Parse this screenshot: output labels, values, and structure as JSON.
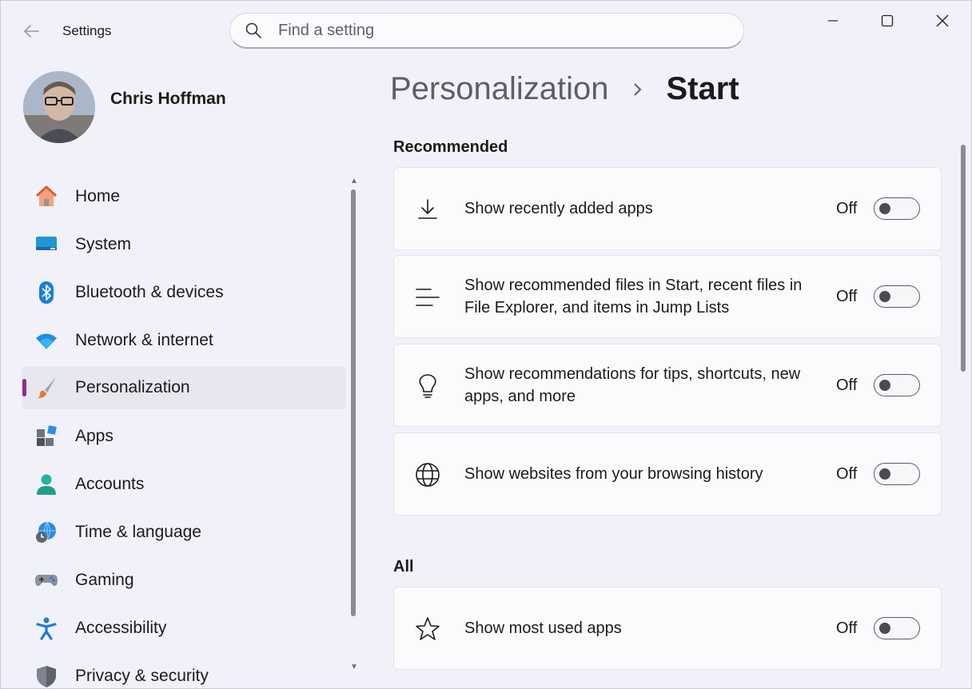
{
  "window": {
    "title": "Settings"
  },
  "search": {
    "placeholder": "Find a setting"
  },
  "profile": {
    "name": "Chris Hoffman"
  },
  "breadcrumb": {
    "parent": "Personalization",
    "separator": "›",
    "current": "Start"
  },
  "nav": {
    "items": [
      {
        "label": "Home",
        "icon": "home-icon"
      },
      {
        "label": "System",
        "icon": "system-display-icon"
      },
      {
        "label": "Bluetooth & devices",
        "icon": "bluetooth-icon"
      },
      {
        "label": "Network & internet",
        "icon": "wifi-icon"
      },
      {
        "label": "Personalization",
        "icon": "paintbrush-icon",
        "selected": true
      },
      {
        "label": "Apps",
        "icon": "apps-icon"
      },
      {
        "label": "Accounts",
        "icon": "person-icon"
      },
      {
        "label": "Time & language",
        "icon": "globe-clock-icon"
      },
      {
        "label": "Gaming",
        "icon": "gamepad-icon"
      },
      {
        "label": "Accessibility",
        "icon": "accessibility-icon"
      },
      {
        "label": "Privacy & security",
        "icon": "shield-icon"
      }
    ]
  },
  "sections": {
    "recommended": {
      "label": "Recommended",
      "settings": [
        {
          "label": "Show recently added apps",
          "state": "Off",
          "icon": "download-icon"
        },
        {
          "label": "Show recommended files in Start, recent files in File Explorer, and items in Jump Lists",
          "state": "Off",
          "icon": "list-lines-icon"
        },
        {
          "label": "Show recommendations for tips, shortcuts, new apps, and more",
          "state": "Off",
          "icon": "lightbulb-icon"
        },
        {
          "label": "Show websites from your browsing history",
          "state": "Off",
          "icon": "globe-icon"
        }
      ]
    },
    "all": {
      "label": "All",
      "settings": [
        {
          "label": "Show most used apps",
          "state": "Off",
          "icon": "star-icon"
        }
      ]
    }
  },
  "colors": {
    "accent": "#8e2b9e",
    "background": "#f1f2f9",
    "card": "#fbfbfd"
  }
}
